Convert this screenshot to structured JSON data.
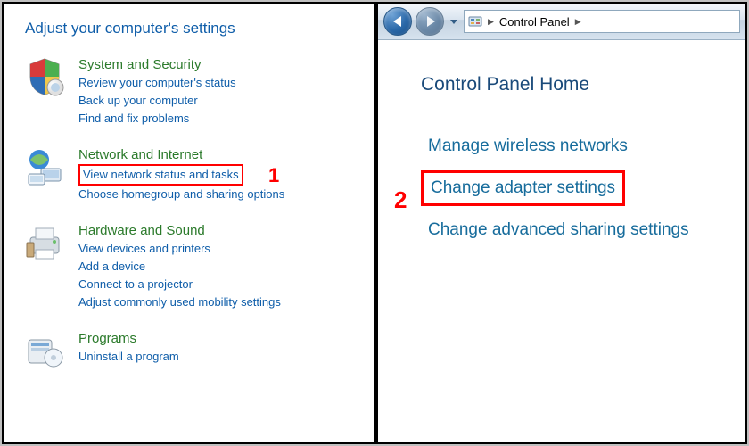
{
  "left": {
    "title": "Adjust your computer's settings",
    "categories": [
      {
        "heading": "System and Security",
        "links": [
          "Review your computer's status",
          "Back up your computer",
          "Find and fix problems"
        ]
      },
      {
        "heading": "Network and Internet",
        "links": [
          "View network status and tasks",
          "Choose homegroup and sharing options"
        ]
      },
      {
        "heading": "Hardware and Sound",
        "links": [
          "View devices and printers",
          "Add a device",
          "Connect to a projector",
          "Adjust commonly used mobility settings"
        ]
      },
      {
        "heading": "Programs",
        "links": [
          "Uninstall a program"
        ]
      }
    ]
  },
  "annotations": {
    "one": "1",
    "two": "2"
  },
  "right": {
    "breadcrumb": "Control Panel",
    "heading": "Control Panel Home",
    "links": [
      "Manage wireless networks",
      "Change adapter settings",
      "Change advanced sharing settings"
    ]
  }
}
